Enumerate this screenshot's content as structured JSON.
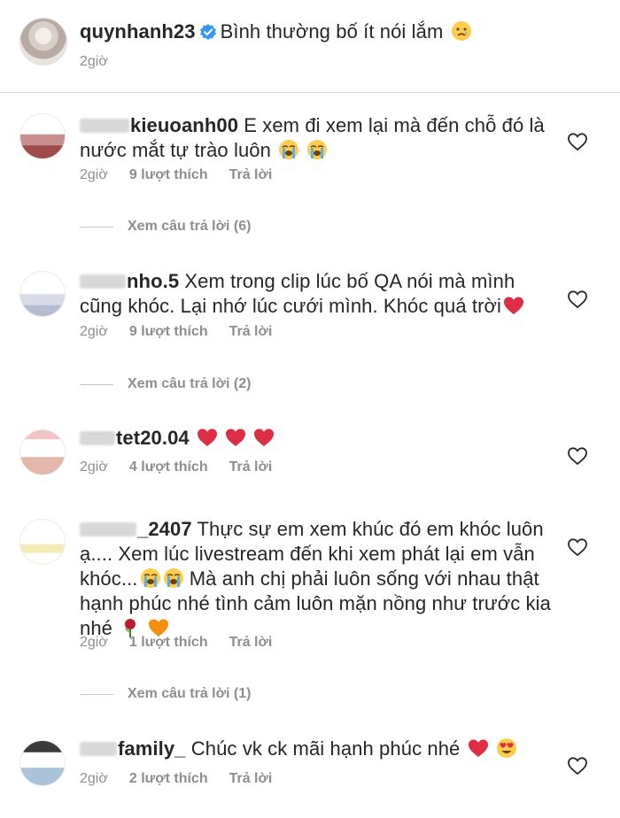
{
  "post": {
    "username": "quynhanh23",
    "caption": "Bình thường bố ít nói lắm",
    "time": "2giờ"
  },
  "comments": [
    {
      "username": "kieuoanh00",
      "text_line1": "E xem đi xem lại mà đến chỗ đó là",
      "text_line2": "nước mắt tự trào luôn",
      "time": "2giờ",
      "likes": "9 lượt thích",
      "reply": "Trả lời",
      "view_replies": "Xem câu trả lời (6)"
    },
    {
      "username": "nho.5",
      "text_line1": "Xem trong clip lúc bố QA nói mà mình",
      "text_line2": "cũng khóc. Lại nhớ lúc cưới mình. Khóc quá trời",
      "time": "2giờ",
      "likes": "9 lượt thích",
      "reply": "Trả lời",
      "view_replies": "Xem câu trả lời (2)"
    },
    {
      "username": "tet20.04",
      "text_line1": "",
      "time": "2giờ",
      "likes": "4 lượt thích",
      "reply": "Trả lời"
    },
    {
      "username": "_2407",
      "text_line1": "Thực sự em xem khúc đó em khóc luôn",
      "text_line2": "ạ.... Xem lúc livestream đến khi xem phát lại em vẫn",
      "text_line3": "khóc...",
      "text_line3b": "Mà anh chị phải luôn sống với nhau thật",
      "text_line4": "hạnh phúc nhé tình cảm luôn mặn nồng như trước kia",
      "text_line5": "nhé",
      "time": "2giờ",
      "likes": "1 lượt thích",
      "reply": "Trả lời",
      "view_replies": "Xem câu trả lời (1)"
    },
    {
      "username": "family_",
      "text_line1": "Chúc vk ck mãi hạnh phúc nhé",
      "time": "2giờ",
      "likes": "2 lượt thích",
      "reply": "Trả lời"
    }
  ],
  "colors": {
    "text": "#262626",
    "meta": "#8e8e8e",
    "heart": "#ed4956",
    "verified": "#3897f0"
  },
  "icons": [
    "verified-badge-icon",
    "heart-outline-icon",
    "red-heart-emoji",
    "crying-emoji",
    "sad-tear-emoji",
    "rose-emoji",
    "orange-heart-emoji",
    "heart-eyes-emoji"
  ]
}
